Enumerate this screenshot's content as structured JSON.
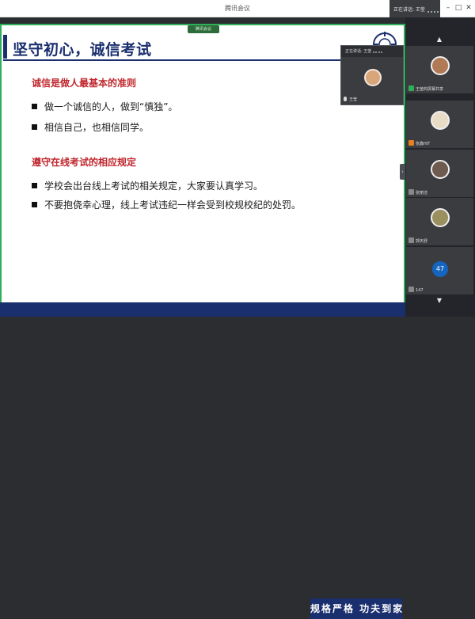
{
  "window": {
    "title": "腾讯会议",
    "speaking_label": "正在讲话: 王莹"
  },
  "share_pill": "腾讯会议",
  "slide": {
    "title": "坚守初心，诚信考试",
    "sections": [
      {
        "heading": "诚信是做人最基本的准则",
        "bullets": [
          "做一个诚信的人，做到“慎独”。",
          "相信自己，也相信同学。"
        ]
      },
      {
        "heading": "遵守在线考试的相应规定",
        "bullets": [
          "学校会出台线上考试的相关规定，大家要认真学习。",
          "不要抱侥幸心理，线上考试违纪一样会受到校规校纪的处罚。"
        ]
      }
    ],
    "slogan": "规格严格 功夫到家"
  },
  "floating_video": {
    "header": "正在讲话: 王莹",
    "name": "王莹"
  },
  "participants": [
    {
      "name": "王莹的屏幕共享",
      "badge_color": "#2fae5b"
    },
    {
      "name": "张鑫HIT",
      "badge_color": "#e67e22"
    },
    {
      "name": "张丽洁",
      "badge_color": "#888888"
    },
    {
      "name": "郭天舒",
      "badge_color": "#888888"
    },
    {
      "name": "147",
      "badge_color": "#888888",
      "count": "47"
    }
  ],
  "colors": {
    "title_navy": "#1a2f6e",
    "heading_red": "#c0272d",
    "frame_green": "#2fae5b"
  },
  "icons": [
    "minimize-icon",
    "maximize-icon",
    "close-icon",
    "mic-icon",
    "chevron-up-icon",
    "chevron-down-icon",
    "collapse-arrow-icon",
    "school-emblem-icon"
  ]
}
